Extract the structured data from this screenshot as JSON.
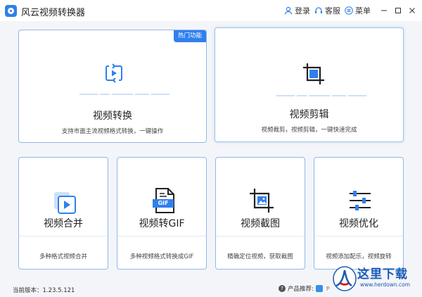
{
  "app": {
    "title": "风云视频转换器",
    "logo_icon": "app-logo-icon"
  },
  "titlebar": {
    "login_label": "登录",
    "service_label": "客服",
    "menu_label": "菜单",
    "login_icon": "user-icon",
    "service_icon": "headset-icon",
    "menu_icon": "menu-icon"
  },
  "colors": {
    "accent": "#2f80ed",
    "card_border": "#8fb8ec",
    "background": "#f4f5f8"
  },
  "cards": {
    "convert": {
      "badge": "热门功能",
      "title": "视频转换",
      "desc": "支持市面主流视频格式转换，一键操作",
      "icon": "video-convert-icon"
    },
    "edit": {
      "title": "视频剪辑",
      "desc": "视频裁剪，视频剪辑，一键快速完成",
      "icon": "crop-icon"
    },
    "merge": {
      "title": "视频合并",
      "desc": "多种格式视频合并",
      "icon": "video-merge-icon"
    },
    "gif": {
      "title": "视频转GIF",
      "desc": "多种视频格式转换成GIF",
      "icon": "gif-file-icon",
      "icon_text": "GIF"
    },
    "screenshot": {
      "title": "视频截图",
      "desc": "精确定位视频，获取截图",
      "icon": "image-crop-icon"
    },
    "optimize": {
      "title": "视频优化",
      "desc": "视频添加配乐，视频旋转",
      "icon": "sliders-icon"
    }
  },
  "footer": {
    "version_label": "当前版本：1.23.5.121",
    "recommend_label": "产品推荐:",
    "recommend_extra": "Ᵽ"
  },
  "watermark": {
    "text": "这里下载",
    "url": "www.herdown.com"
  }
}
